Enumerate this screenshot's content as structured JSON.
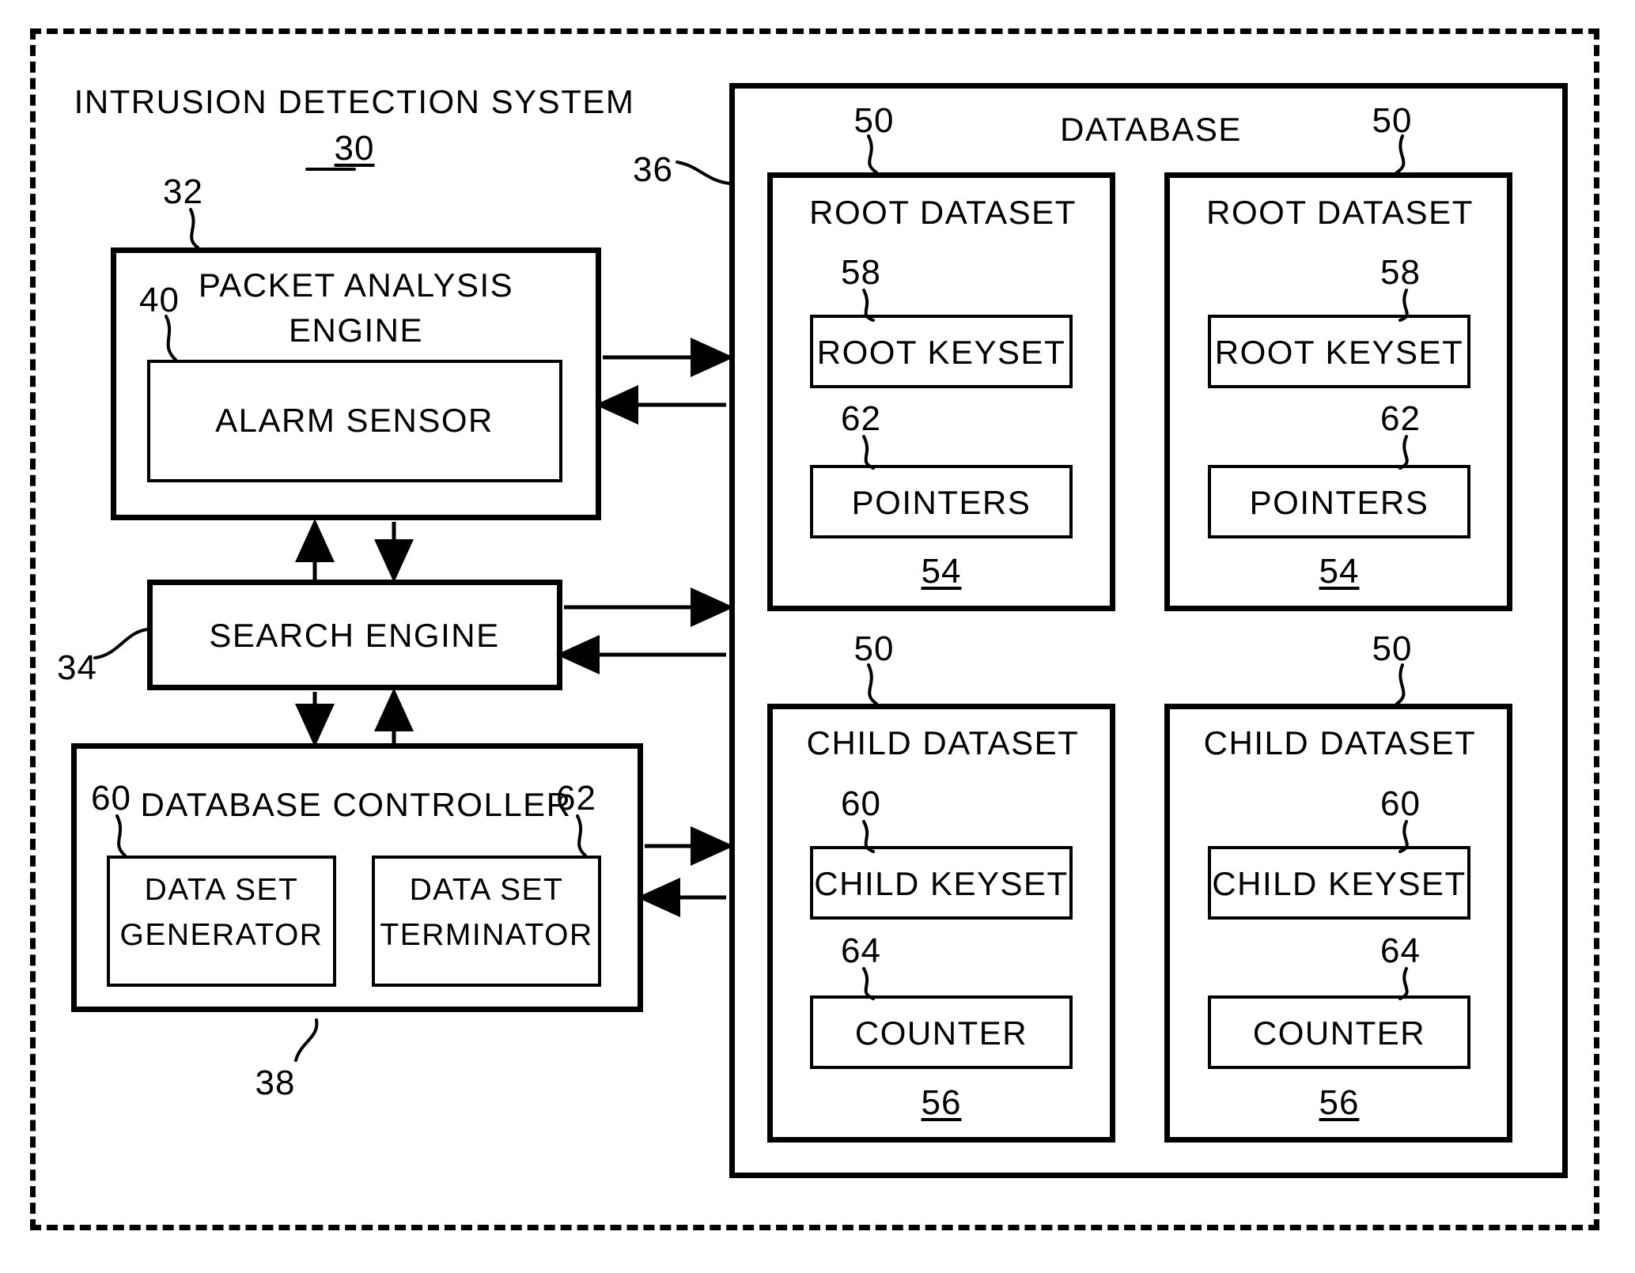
{
  "figure": {
    "system": {
      "title": "INTRUSION DETECTION SYSTEM",
      "ref": "30",
      "boundary_ref": "36"
    },
    "left_column": {
      "packet_analysis_engine": {
        "label": "PACKET ANALYSIS\nENGINE",
        "title_line1": "PACKET ANALYSIS",
        "title_line2": "ENGINE",
        "ref": "32",
        "inner": {
          "label": "ALARM SENSOR",
          "ref": "40"
        }
      },
      "search_engine": {
        "label": "SEARCH ENGINE",
        "ref": "34"
      },
      "database_controller": {
        "label": "DATABASE CONTROLLER",
        "ref": "38",
        "inner_left": {
          "line1": "DATA SET",
          "line2": "GENERATOR",
          "ref": "60"
        },
        "inner_right": {
          "line1": "DATA SET",
          "line2": "TERMINATOR",
          "ref": "62"
        }
      }
    },
    "database": {
      "title": "DATABASE",
      "datasets": [
        {
          "kind": "root",
          "title": "ROOT DATASET",
          "top_ref": "50",
          "bottom_ref": "54",
          "field1": {
            "label": "ROOT KEYSET",
            "ref": "58"
          },
          "field2": {
            "label": "POINTERS",
            "ref": "62"
          }
        },
        {
          "kind": "root",
          "title": "ROOT DATASET",
          "top_ref": "50",
          "bottom_ref": "54",
          "field1": {
            "label": "ROOT KEYSET",
            "ref": "58"
          },
          "field2": {
            "label": "POINTERS",
            "ref": "62"
          }
        },
        {
          "kind": "child",
          "title": "CHILD DATASET",
          "top_ref": "50",
          "bottom_ref": "56",
          "field1": {
            "label": "CHILD KEYSET",
            "ref": "60"
          },
          "field2": {
            "label": "COUNTER",
            "ref": "64"
          }
        },
        {
          "kind": "child",
          "title": "CHILD DATASET",
          "top_ref": "50",
          "bottom_ref": "56",
          "field1": {
            "label": "CHILD KEYSET",
            "ref": "60"
          },
          "field2": {
            "label": "COUNTER",
            "ref": "64"
          }
        }
      ]
    },
    "colors": {
      "ink": "#000000",
      "paper": "#ffffff"
    }
  }
}
